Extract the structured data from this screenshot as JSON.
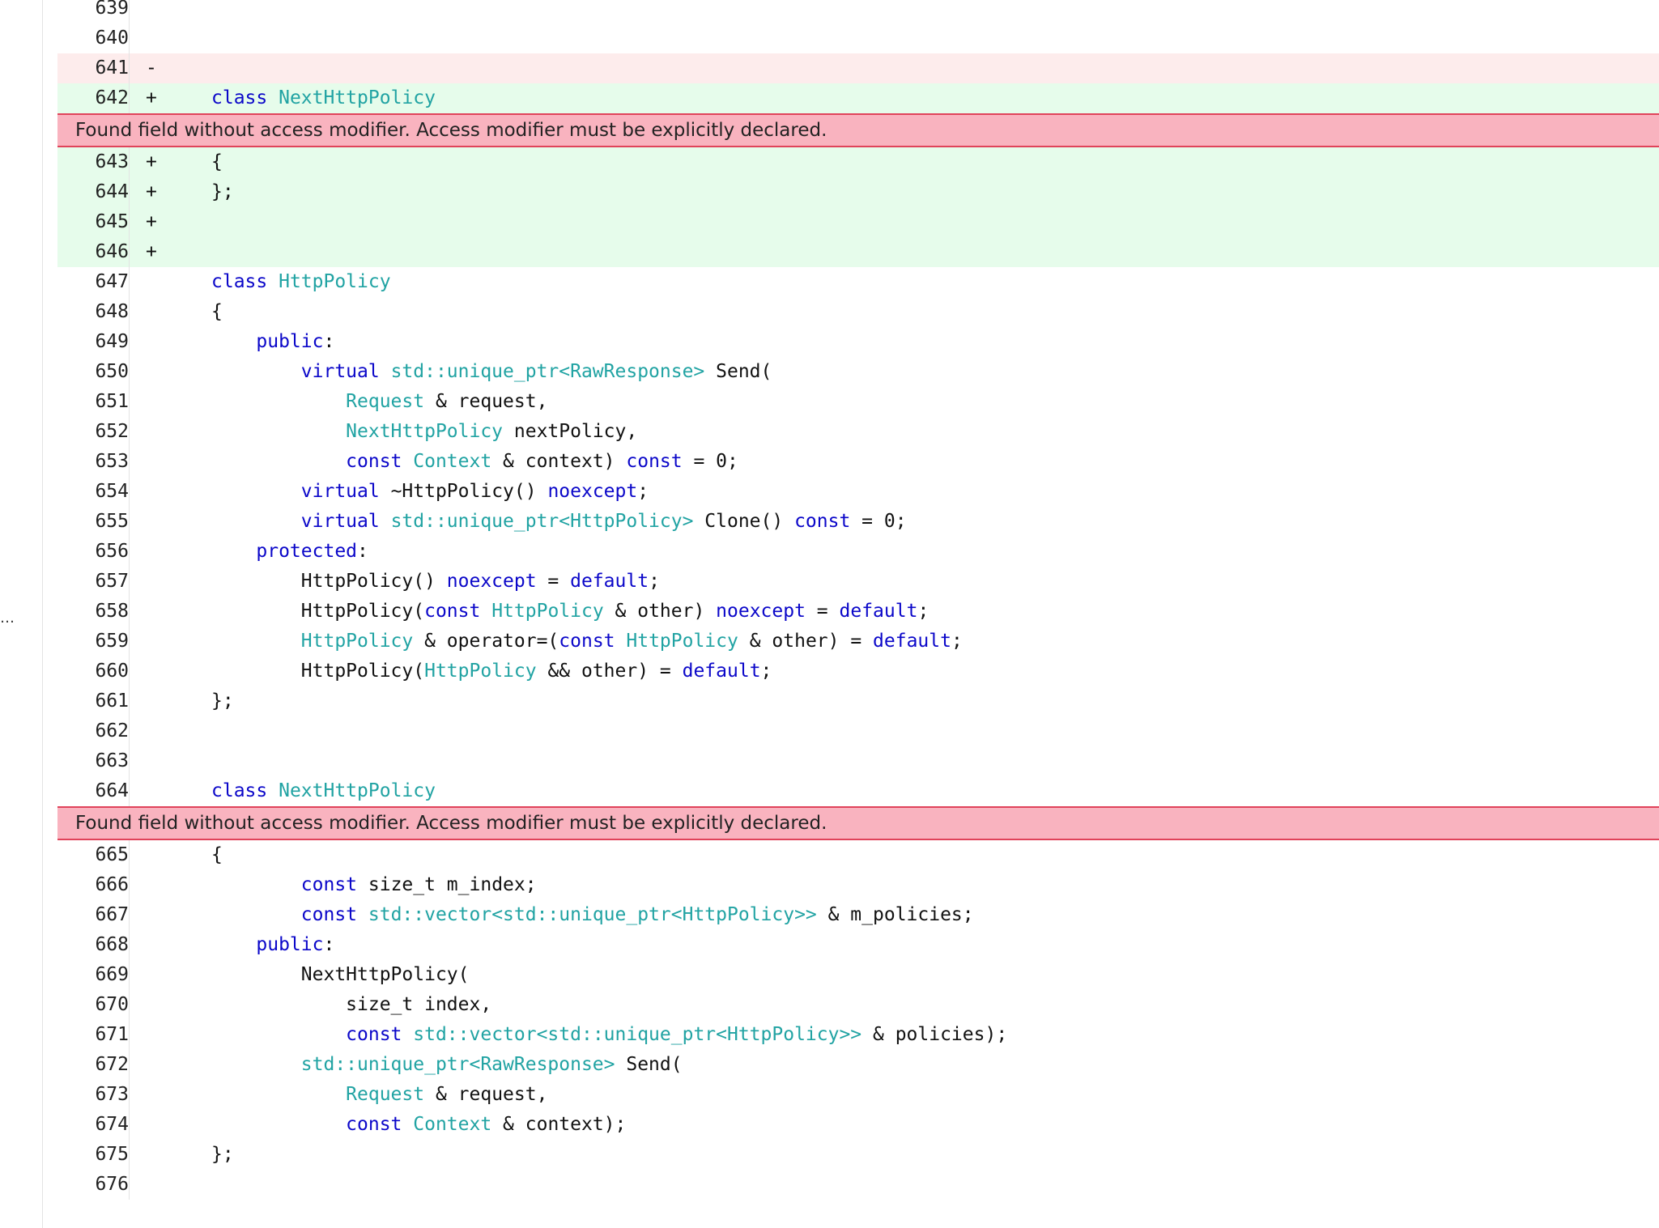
{
  "gutter": {
    "ellipsis": "…"
  },
  "warning_message": "Found field without access modifier. Access modifier must be explicitly declared.",
  "lines": [
    {
      "type": "context",
      "num": "639",
      "mark": "",
      "tokens": []
    },
    {
      "type": "context",
      "num": "640",
      "mark": "",
      "tokens": []
    },
    {
      "type": "removed",
      "num": "641",
      "mark": "-",
      "tokens": []
    },
    {
      "type": "added",
      "num": "642",
      "mark": "+",
      "tokens": [
        [
          "kw",
          "class "
        ],
        [
          "type",
          "NextHttpPolicy"
        ]
      ]
    },
    {
      "type": "warning",
      "text": "Found field without access modifier. Access modifier must be explicitly declared."
    },
    {
      "type": "added",
      "num": "643",
      "mark": "+",
      "tokens": [
        [
          "plain",
          "{"
        ]
      ]
    },
    {
      "type": "added",
      "num": "644",
      "mark": "+",
      "tokens": [
        [
          "plain",
          "};"
        ]
      ]
    },
    {
      "type": "added",
      "num": "645",
      "mark": "+",
      "tokens": []
    },
    {
      "type": "added",
      "num": "646",
      "mark": "+",
      "tokens": []
    },
    {
      "type": "context",
      "num": "647",
      "mark": "",
      "tokens": [
        [
          "kw",
          "class "
        ],
        [
          "type",
          "HttpPolicy"
        ]
      ]
    },
    {
      "type": "context",
      "num": "648",
      "mark": "",
      "tokens": [
        [
          "plain",
          "{"
        ]
      ]
    },
    {
      "type": "context",
      "num": "649",
      "mark": "",
      "tokens": [
        [
          "plain",
          "    "
        ],
        [
          "kw",
          "public"
        ],
        [
          "plain",
          ":"
        ]
      ]
    },
    {
      "type": "context",
      "num": "650",
      "mark": "",
      "tokens": [
        [
          "plain",
          "        "
        ],
        [
          "kw",
          "virtual "
        ],
        [
          "type",
          "std::unique_ptr<RawResponse>"
        ],
        [
          "plain",
          " Send("
        ]
      ]
    },
    {
      "type": "context",
      "num": "651",
      "mark": "",
      "tokens": [
        [
          "plain",
          "            "
        ],
        [
          "type",
          "Request"
        ],
        [
          "plain",
          " & request,"
        ]
      ]
    },
    {
      "type": "context",
      "num": "652",
      "mark": "",
      "tokens": [
        [
          "plain",
          "            "
        ],
        [
          "type",
          "NextHttpPolicy"
        ],
        [
          "plain",
          " nextPolicy,"
        ]
      ]
    },
    {
      "type": "context",
      "num": "653",
      "mark": "",
      "tokens": [
        [
          "plain",
          "            "
        ],
        [
          "kw",
          "const "
        ],
        [
          "type",
          "Context"
        ],
        [
          "plain",
          " & context) "
        ],
        [
          "kw",
          "const"
        ],
        [
          "plain",
          " = 0;"
        ]
      ]
    },
    {
      "type": "context",
      "num": "654",
      "mark": "",
      "tokens": [
        [
          "plain",
          "        "
        ],
        [
          "kw",
          "virtual"
        ],
        [
          "plain",
          " ~HttpPolicy() "
        ],
        [
          "kw",
          "noexcept"
        ],
        [
          "plain",
          ";"
        ]
      ]
    },
    {
      "type": "context",
      "num": "655",
      "mark": "",
      "tokens": [
        [
          "plain",
          "        "
        ],
        [
          "kw",
          "virtual "
        ],
        [
          "type",
          "std::unique_ptr<HttpPolicy>"
        ],
        [
          "plain",
          " Clone() "
        ],
        [
          "kw",
          "const"
        ],
        [
          "plain",
          " = 0;"
        ]
      ]
    },
    {
      "type": "context",
      "num": "656",
      "mark": "",
      "tokens": [
        [
          "plain",
          "    "
        ],
        [
          "kw",
          "protected"
        ],
        [
          "plain",
          ":"
        ]
      ]
    },
    {
      "type": "context",
      "num": "657",
      "mark": "",
      "tokens": [
        [
          "plain",
          "        HttpPolicy() "
        ],
        [
          "kw",
          "noexcept"
        ],
        [
          "plain",
          " = "
        ],
        [
          "kw",
          "default"
        ],
        [
          "plain",
          ";"
        ]
      ]
    },
    {
      "type": "context",
      "num": "658",
      "mark": "",
      "tokens": [
        [
          "plain",
          "        HttpPolicy("
        ],
        [
          "kw",
          "const "
        ],
        [
          "type",
          "HttpPolicy"
        ],
        [
          "plain",
          " & other) "
        ],
        [
          "kw",
          "noexcept"
        ],
        [
          "plain",
          " = "
        ],
        [
          "kw",
          "default"
        ],
        [
          "plain",
          ";"
        ]
      ]
    },
    {
      "type": "context",
      "num": "659",
      "mark": "",
      "tokens": [
        [
          "plain",
          "        "
        ],
        [
          "type",
          "HttpPolicy"
        ],
        [
          "plain",
          " & operator=("
        ],
        [
          "kw",
          "const "
        ],
        [
          "type",
          "HttpPolicy"
        ],
        [
          "plain",
          " & other) = "
        ],
        [
          "kw",
          "default"
        ],
        [
          "plain",
          ";"
        ]
      ]
    },
    {
      "type": "context",
      "num": "660",
      "mark": "",
      "tokens": [
        [
          "plain",
          "        HttpPolicy("
        ],
        [
          "type",
          "HttpPolicy"
        ],
        [
          "plain",
          " && other) = "
        ],
        [
          "kw",
          "default"
        ],
        [
          "plain",
          ";"
        ]
      ]
    },
    {
      "type": "context",
      "num": "661",
      "mark": "",
      "tokens": [
        [
          "plain",
          "};"
        ]
      ]
    },
    {
      "type": "context",
      "num": "662",
      "mark": "",
      "tokens": []
    },
    {
      "type": "context",
      "num": "663",
      "mark": "",
      "tokens": []
    },
    {
      "type": "context",
      "num": "664",
      "mark": "",
      "tokens": [
        [
          "kw",
          "class "
        ],
        [
          "type",
          "NextHttpPolicy"
        ]
      ]
    },
    {
      "type": "warning",
      "text": "Found field without access modifier. Access modifier must be explicitly declared."
    },
    {
      "type": "context",
      "num": "665",
      "mark": "",
      "tokens": [
        [
          "plain",
          "{"
        ]
      ]
    },
    {
      "type": "context",
      "num": "666",
      "mark": "",
      "tokens": [
        [
          "plain",
          "        "
        ],
        [
          "kw",
          "const"
        ],
        [
          "plain",
          " size_t m_index;"
        ]
      ]
    },
    {
      "type": "context",
      "num": "667",
      "mark": "",
      "tokens": [
        [
          "plain",
          "        "
        ],
        [
          "kw",
          "const "
        ],
        [
          "type",
          "std::vector<std::unique_ptr<HttpPolicy>>"
        ],
        [
          "plain",
          " & m_policies;"
        ]
      ]
    },
    {
      "type": "context",
      "num": "668",
      "mark": "",
      "tokens": [
        [
          "plain",
          "    "
        ],
        [
          "kw",
          "public"
        ],
        [
          "plain",
          ":"
        ]
      ]
    },
    {
      "type": "context",
      "num": "669",
      "mark": "",
      "tokens": [
        [
          "plain",
          "        NextHttpPolicy("
        ]
      ]
    },
    {
      "type": "context",
      "num": "670",
      "mark": "",
      "tokens": [
        [
          "plain",
          "            size_t index,"
        ]
      ]
    },
    {
      "type": "context",
      "num": "671",
      "mark": "",
      "tokens": [
        [
          "plain",
          "            "
        ],
        [
          "kw",
          "const "
        ],
        [
          "type",
          "std::vector<std::unique_ptr<HttpPolicy>>"
        ],
        [
          "plain",
          " & policies);"
        ]
      ]
    },
    {
      "type": "context",
      "num": "672",
      "mark": "",
      "tokens": [
        [
          "plain",
          "        "
        ],
        [
          "type",
          "std::unique_ptr<RawResponse>"
        ],
        [
          "plain",
          " Send("
        ]
      ]
    },
    {
      "type": "context",
      "num": "673",
      "mark": "",
      "tokens": [
        [
          "plain",
          "            "
        ],
        [
          "type",
          "Request"
        ],
        [
          "plain",
          " & request,"
        ]
      ]
    },
    {
      "type": "context",
      "num": "674",
      "mark": "",
      "tokens": [
        [
          "plain",
          "            "
        ],
        [
          "kw",
          "const "
        ],
        [
          "type",
          "Context"
        ],
        [
          "plain",
          " & context);"
        ]
      ]
    },
    {
      "type": "context",
      "num": "675",
      "mark": "",
      "tokens": [
        [
          "plain",
          "};"
        ]
      ]
    },
    {
      "type": "context",
      "num": "676",
      "mark": "",
      "tokens": []
    }
  ]
}
